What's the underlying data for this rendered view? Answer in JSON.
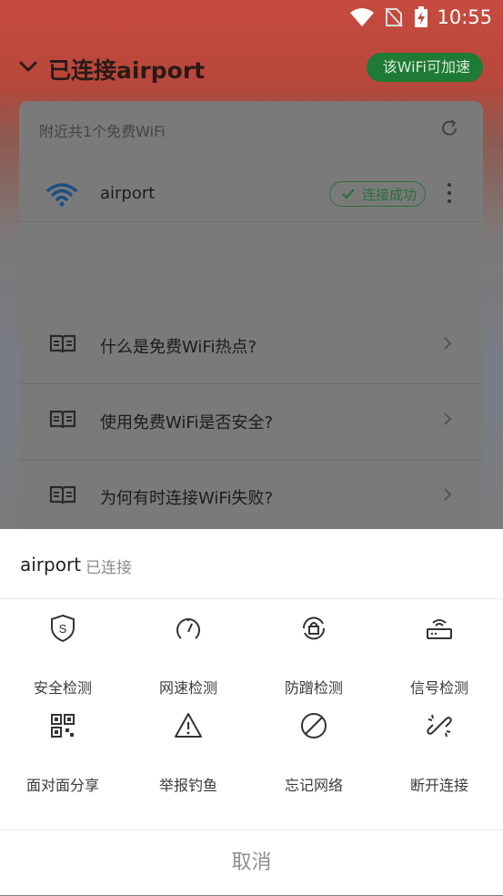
{
  "status_bar": {
    "time": "10:55",
    "icons": [
      "wifi-icon",
      "no-sim-icon",
      "battery-charging-icon"
    ]
  },
  "header": {
    "title": "已连接airport",
    "speed_button": "该WiFi可加速"
  },
  "card": {
    "header": "附近共1个免费WiFi",
    "network": {
      "name": "airport",
      "status": "连接成功"
    },
    "faq": [
      "什么是免费WiFi热点?",
      "使用免费WiFi是否安全?",
      "为何有时连接WiFi失败?"
    ]
  },
  "sheet": {
    "ssid": "airport",
    "state": "已连接",
    "actions": [
      {
        "label": "安全检测",
        "icon": "shield-s-icon"
      },
      {
        "label": "网速检测",
        "icon": "speedometer-icon"
      },
      {
        "label": "防蹭检测",
        "icon": "lock-refresh-icon"
      },
      {
        "label": "信号检测",
        "icon": "router-icon"
      },
      {
        "label": "面对面分享",
        "icon": "qr-code-icon"
      },
      {
        "label": "举报钓鱼",
        "icon": "warning-icon"
      },
      {
        "label": "忘记网络",
        "icon": "forbidden-icon"
      },
      {
        "label": "断开连接",
        "icon": "broken-link-icon"
      }
    ],
    "cancel": "取消"
  },
  "colors": {
    "accent_green": "#2d8a3e",
    "header_red": "#c74a3f"
  }
}
